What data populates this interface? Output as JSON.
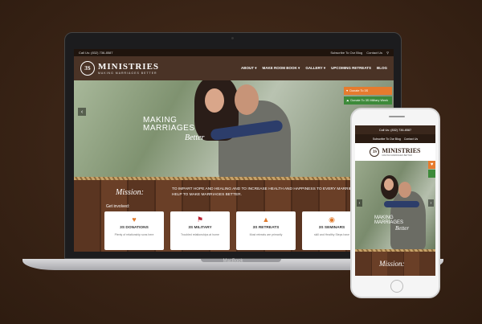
{
  "laptop_label": "MacBook",
  "site": {
    "topbar": {
      "call": "Call Us: (832) 736-8587",
      "subscribe": "Subscribe To Our Blog",
      "contact": "Contact Us"
    },
    "logo": {
      "mark": "3S",
      "name": "MINISTRIES",
      "tagline": "MAKING MARRIAGES BETTER"
    },
    "menu": [
      "ABOUT ▾",
      "MAKE ROOM BOOK ▾",
      "GALLERY ▾",
      "UPCOMING RETREATS",
      "BLOG"
    ],
    "hero": {
      "line1": "MAKING",
      "line2": "MARRIAGES",
      "script": "Better",
      "donate": "Donate To 3S",
      "military": "Donate To 3S Military Week"
    },
    "mission": {
      "label": "Mission:",
      "text": "To impart hope and healing and to increase health and happiness to every married couple. We help to make marriages better."
    },
    "get_involved": "Get involved:",
    "cards": [
      {
        "title": "3S DONATIONS",
        "desc": "Plenty of relationship sons here"
      },
      {
        "title": "3S MILITARY",
        "desc": "Troubled relationships at home"
      },
      {
        "title": "3S RETREATS",
        "desc": "Most retreats are primarily"
      },
      {
        "title": "3S SEMINARS",
        "desc": "skill and Healthy Steps have"
      }
    ]
  },
  "phone": {
    "call": "Call Us: (832) 736-8587",
    "subscribe": "Subscribe To Our Blog",
    "contact": "Contact Us",
    "logo_mark": "3S",
    "logo_name": "MINISTRIES",
    "logo_tagline": "MAKING MARRIAGES BETTER",
    "hero_line1": "MAKING",
    "hero_line2": "MARRIAGES",
    "hero_script": "Better",
    "mission": "Mission:"
  },
  "icons": {
    "card_icons": [
      "heart-icon",
      "flag-icon",
      "cabin-icon",
      "speech-bubble-icon"
    ],
    "nav": [
      "search-icon",
      "chevron-left-icon",
      "chevron-right-icon"
    ]
  },
  "colors": {
    "brand_brown": "#4a3326",
    "accent_orange": "#e67b2e",
    "accent_green": "#3d8a3a",
    "background": "#3a2416"
  }
}
